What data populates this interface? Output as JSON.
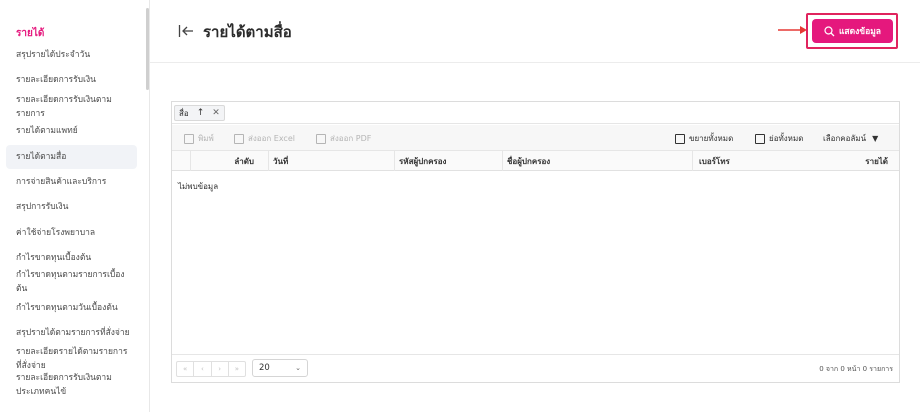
{
  "sidebar": {
    "section_title": "รายได้",
    "items": [
      {
        "label": "สรุปรายได้ประจำวัน"
      },
      {
        "label": "รายละเอียดการรับเงิน"
      },
      {
        "label": "รายละเอียดการรับเงินตามรายการ"
      },
      {
        "label": "รายได้ตามแพทย์"
      },
      {
        "label": "รายได้ตามสื่อ"
      },
      {
        "label": "การจ่ายสินค้าและบริการ"
      },
      {
        "label": "สรุปการรับเงิน"
      },
      {
        "label": "ค่าใช้จ่ายโรงพยาบาล"
      },
      {
        "label": "กำไรขาดทุนเบื้องต้น"
      },
      {
        "label": "กำไรขาดทุนตามรายการเบื้องต้น"
      },
      {
        "label": "กำไรขาดทุนตามวันเบื้องต้น"
      },
      {
        "label": "สรุปรายได้ตามรายการที่สั่งจ่าย"
      },
      {
        "label": "รายละเอียดรายได้ตามรายการที่สั่งจ่าย"
      },
      {
        "label": "รายละเอียดการรับเงินตามประเภทคนไข้"
      }
    ]
  },
  "header": {
    "title": "รายได้ตามสื่อ",
    "show_button": "แสดงข้อมูล"
  },
  "grid": {
    "group_chip": "สื่อ",
    "toolbar": {
      "print": "พิมพ์",
      "export_excel": "ส่งออก Excel",
      "export_pdf": "ส่งออก PDF",
      "expand_all": "ขยายทั้งหมด",
      "collapse_all": "ย่อทั้งหมด",
      "choose_columns": "เลือกคอลัมน์"
    },
    "columns": [
      "ลำดับ",
      "วันที่",
      "รหัสผู้ปกครอง",
      "ชื่อผู้ปกครอง",
      "เบอร์โทร",
      "รายได้"
    ],
    "empty_message": "ไม่พบข้อมูล",
    "pager": {
      "page_size": "20",
      "info": "0 จาก 0 หน้า 0 รายการ"
    }
  },
  "colors": {
    "accent": "#e5187d",
    "highlight_border": "#e0245e"
  }
}
